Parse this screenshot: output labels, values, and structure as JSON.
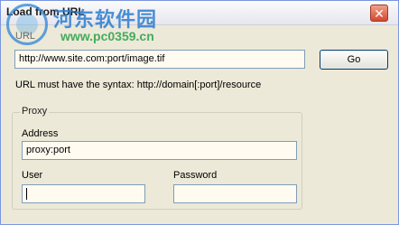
{
  "window": {
    "title": "Load from URL",
    "close_glyph": "✕"
  },
  "watermark": {
    "name": "河东软件园",
    "url": "www.pc0359.cn"
  },
  "url_section": {
    "label": "URL",
    "value": "http://www.site.com:port/image.tif",
    "go_label": "Go",
    "hint": "URL must have the syntax: http://domain[:port]/resource"
  },
  "proxy": {
    "group_label": "Proxy",
    "address_label": "Address",
    "address_value": "proxy:port",
    "user_label": "User",
    "user_value": "",
    "password_label": "Password",
    "password_value": ""
  },
  "colors": {
    "dialog_bg": "#ece9d8",
    "input_bg": "#fffbf0",
    "close_red": "#d5472d"
  }
}
